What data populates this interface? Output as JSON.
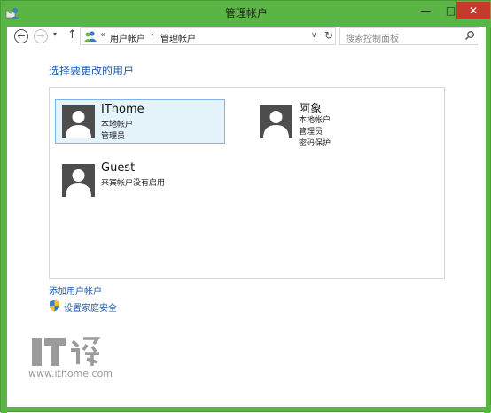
{
  "window": {
    "title": "管理帐户",
    "controls": {
      "minimize": "—",
      "maximize": "□",
      "close": "✕"
    },
    "accent_color": "#5bb544",
    "close_color": "#c7392b"
  },
  "navigation": {
    "back": "←",
    "forward": "→",
    "recent": "▾",
    "up": "↑",
    "address": {
      "overflow": "«",
      "separator": "›",
      "crumbs": [
        "用户帐户",
        "管理帐户"
      ],
      "dropdown": "∨",
      "refresh": "↻"
    },
    "search": {
      "placeholder": "搜索控制面板"
    }
  },
  "main": {
    "heading": "选择要更改的用户",
    "heading_color": "#1e5aa8",
    "users": [
      {
        "name": "IThome",
        "lines": [
          "本地帐户",
          "管理员"
        ],
        "selected": true
      },
      {
        "name": "阿象",
        "lines": [
          "本地帐户",
          "管理员",
          "密码保护"
        ],
        "selected": false
      },
      {
        "name": "Guest",
        "lines": [
          "来宾帐户没有启用"
        ],
        "selected": false
      }
    ],
    "links": {
      "add_account": "添加用户帐户",
      "family_safety": "设置家庭安全"
    }
  },
  "watermark": {
    "url": "www.ithome.com"
  }
}
